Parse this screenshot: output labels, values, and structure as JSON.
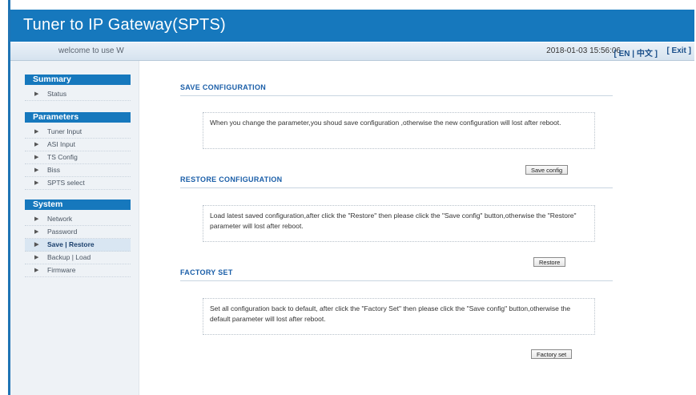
{
  "header": {
    "title": "Tuner to IP Gateway(SPTS)",
    "welcome": "welcome to use W",
    "datetime": "2018-01-03 15:56:06",
    "lang": "[ EN | 中文 ]",
    "exit": "[ Exit ]"
  },
  "sidebar": {
    "sections": [
      {
        "label": "Summary",
        "items": [
          "Status"
        ]
      },
      {
        "label": "Parameters",
        "items": [
          "Tuner Input",
          "ASI Input",
          "TS Config",
          "Biss",
          "SPTS select"
        ]
      },
      {
        "label": "System",
        "items": [
          "Network",
          "Password",
          "Save | Restore",
          "Backup | Load",
          "Firmware"
        ]
      }
    ],
    "active_item": "Save | Restore"
  },
  "main": {
    "sections": [
      {
        "title": "SAVE CONFIGURATION",
        "text": "When you change the parameter,you shoud save configuration ,otherwise the new configuration will lost after reboot.",
        "button": "Save config"
      },
      {
        "title": "RESTORE CONFIGURATION",
        "text": "Load latest saved configuration,after click the \"Restore\" then please click the \"Save config\" button,otherwise the \"Restore\" parameter will lost after reboot.",
        "button": "Restore"
      },
      {
        "title": "FACTORY SET",
        "text": "Set all configuration back to default, after click the \"Factory Set\" then please click the \"Save config\" button,otherwise the default parameter will lost after reboot.",
        "button": "Factory set"
      }
    ]
  },
  "colors": {
    "accent": "#1678bd",
    "title_blue": "#1a5ea8"
  }
}
